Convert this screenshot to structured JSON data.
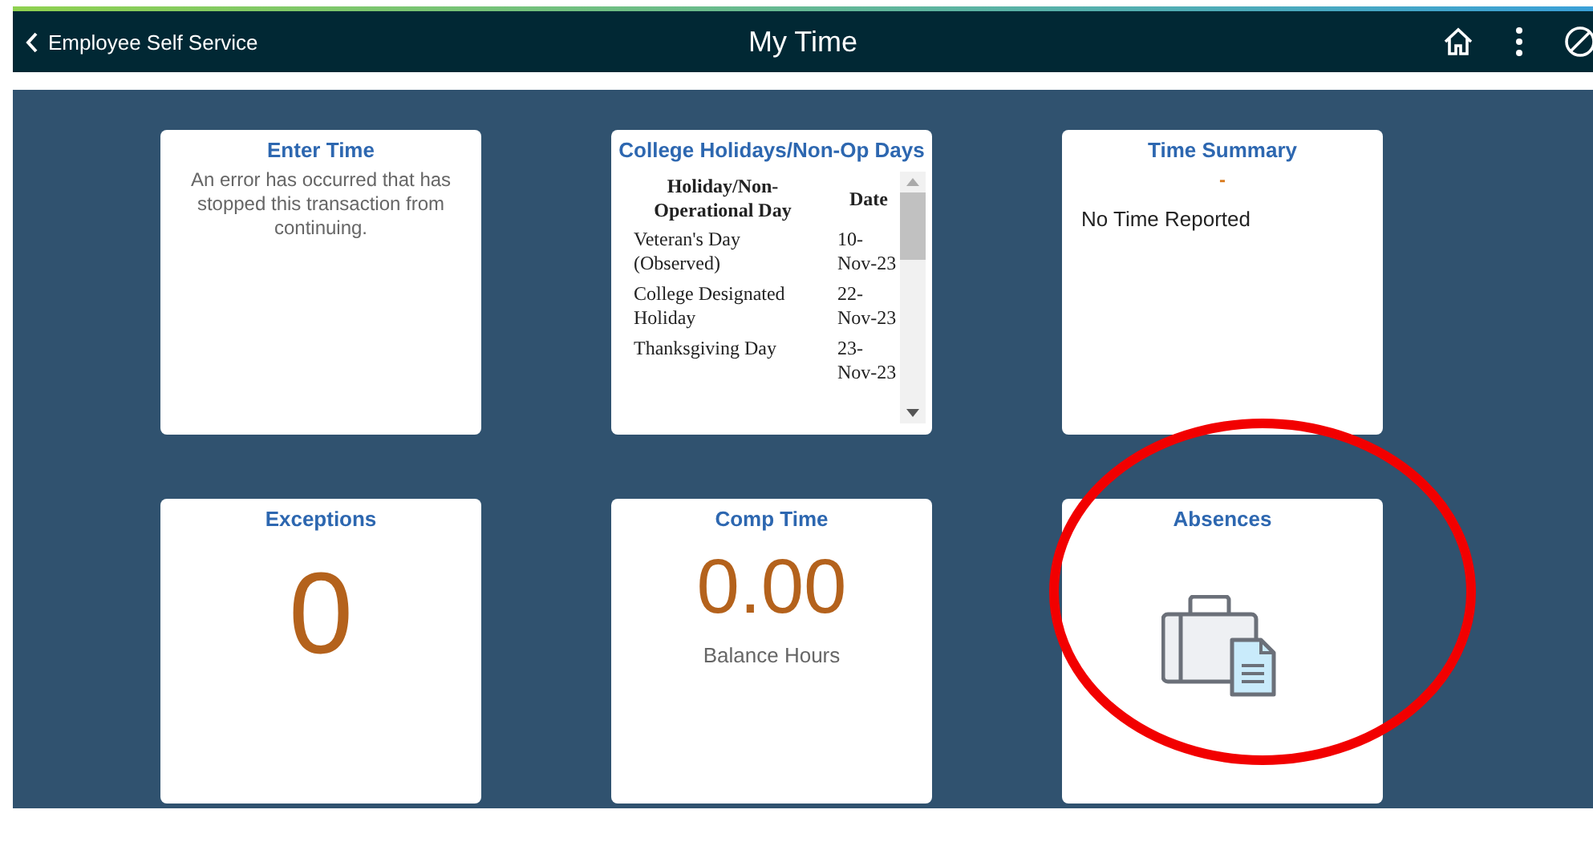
{
  "header": {
    "back_label": "Employee Self Service",
    "title": "My Time"
  },
  "tiles": [
    {
      "kind": "message",
      "title": "Enter Time",
      "text": "An error has occurred that has stopped this transaction from continuing."
    },
    {
      "kind": "table",
      "title": "College Holidays/Non-Op Days",
      "columns": [
        "Holiday/Non-Operational Day",
        "Date"
      ],
      "rows": [
        [
          "Veteran's Day (Observed)",
          "10-Nov-23"
        ],
        [
          "College Designated Holiday",
          "22-Nov-23"
        ],
        [
          "Thanksgiving Day",
          "23-Nov-23"
        ]
      ]
    },
    {
      "kind": "summary",
      "title": "Time Summary",
      "value": "-",
      "text": "No Time Reported"
    },
    {
      "kind": "count",
      "title": "Exceptions",
      "value": "0"
    },
    {
      "kind": "balance",
      "title": "Comp Time",
      "value": "0.00",
      "caption": "Balance Hours"
    },
    {
      "kind": "icon",
      "title": "Absences",
      "highlighted": true
    }
  ]
}
